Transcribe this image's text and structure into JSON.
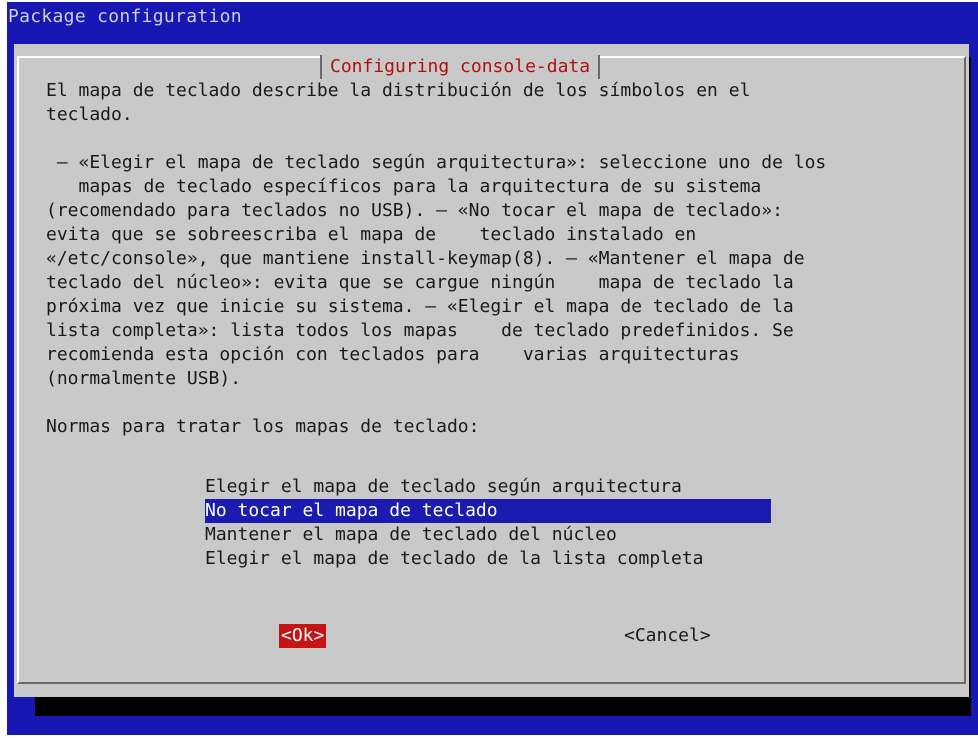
{
  "window": {
    "title": "Package configuration"
  },
  "dialog": {
    "title": "Configuring console-data",
    "body": "El mapa de teclado describe la distribución de los símbolos en el\nteclado.\n\n – «Elegir el mapa de teclado según arquitectura»: seleccione uno de los\n   mapas de teclado específicos para la arquitectura de su sistema\n(recomendado para teclados no USB). – «No tocar el mapa de teclado»:\nevita que se sobreescriba el mapa de    teclado instalado en\n«/etc/console», que mantiene install-keymap(8). – «Mantener el mapa de\nteclado del núcleo»: evita que se cargue ningún    mapa de teclado la\npróxima vez que inicie su sistema. – «Elegir el mapa de teclado de la\nlista completa»: lista todos los mapas    de teclado predefinidos. Se\nrecomienda esta opción con teclados para    varias arquitecturas\n(normalmente USB).\n\nNormas para tratar los mapas de teclado:",
    "options": [
      {
        "label": "Elegir el mapa de teclado según arquitectura",
        "selected": false
      },
      {
        "label": "No tocar el mapa de teclado",
        "selected": true
      },
      {
        "label": "Mantener el mapa de teclado del núcleo",
        "selected": false
      },
      {
        "label": "Elegir el mapa de teclado de la lista completa",
        "selected": false
      }
    ],
    "ok_label": "<Ok>",
    "cancel_label": "<Cancel>"
  },
  "colors": {
    "background": "#1717b3",
    "dialog": "#c9c9c9",
    "title_text": "#b01010",
    "selection": "#1b1bb0",
    "ok_button": "#c41414"
  }
}
